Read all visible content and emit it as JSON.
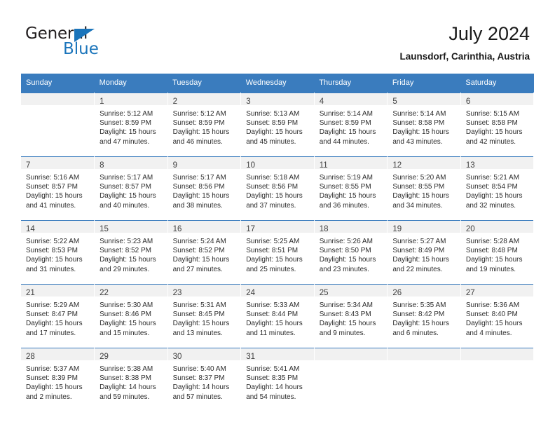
{
  "brand": {
    "name_part1": "General",
    "name_part2": "Blue",
    "accent_color": "#1b75bb"
  },
  "header": {
    "title": "July 2024",
    "subtitle": "Launsdorf, Carinthia, Austria"
  },
  "theme": {
    "header_row_color": "#3a7cbe",
    "daynum_band_color": "#f1f1f1",
    "text_color": "#2b2b2b"
  },
  "weekdays": [
    "Sunday",
    "Monday",
    "Tuesday",
    "Wednesday",
    "Thursday",
    "Friday",
    "Saturday"
  ],
  "weeks": [
    [
      {
        "day": "",
        "sunrise": "",
        "sunset": "",
        "daylight1": "",
        "daylight2": "",
        "empty": true
      },
      {
        "day": "1",
        "sunrise": "Sunrise: 5:12 AM",
        "sunset": "Sunset: 8:59 PM",
        "daylight1": "Daylight: 15 hours",
        "daylight2": "and 47 minutes."
      },
      {
        "day": "2",
        "sunrise": "Sunrise: 5:12 AM",
        "sunset": "Sunset: 8:59 PM",
        "daylight1": "Daylight: 15 hours",
        "daylight2": "and 46 minutes."
      },
      {
        "day": "3",
        "sunrise": "Sunrise: 5:13 AM",
        "sunset": "Sunset: 8:59 PM",
        "daylight1": "Daylight: 15 hours",
        "daylight2": "and 45 minutes."
      },
      {
        "day": "4",
        "sunrise": "Sunrise: 5:14 AM",
        "sunset": "Sunset: 8:59 PM",
        "daylight1": "Daylight: 15 hours",
        "daylight2": "and 44 minutes."
      },
      {
        "day": "5",
        "sunrise": "Sunrise: 5:14 AM",
        "sunset": "Sunset: 8:58 PM",
        "daylight1": "Daylight: 15 hours",
        "daylight2": "and 43 minutes."
      },
      {
        "day": "6",
        "sunrise": "Sunrise: 5:15 AM",
        "sunset": "Sunset: 8:58 PM",
        "daylight1": "Daylight: 15 hours",
        "daylight2": "and 42 minutes."
      }
    ],
    [
      {
        "day": "7",
        "sunrise": "Sunrise: 5:16 AM",
        "sunset": "Sunset: 8:57 PM",
        "daylight1": "Daylight: 15 hours",
        "daylight2": "and 41 minutes."
      },
      {
        "day": "8",
        "sunrise": "Sunrise: 5:17 AM",
        "sunset": "Sunset: 8:57 PM",
        "daylight1": "Daylight: 15 hours",
        "daylight2": "and 40 minutes."
      },
      {
        "day": "9",
        "sunrise": "Sunrise: 5:17 AM",
        "sunset": "Sunset: 8:56 PM",
        "daylight1": "Daylight: 15 hours",
        "daylight2": "and 38 minutes."
      },
      {
        "day": "10",
        "sunrise": "Sunrise: 5:18 AM",
        "sunset": "Sunset: 8:56 PM",
        "daylight1": "Daylight: 15 hours",
        "daylight2": "and 37 minutes."
      },
      {
        "day": "11",
        "sunrise": "Sunrise: 5:19 AM",
        "sunset": "Sunset: 8:55 PM",
        "daylight1": "Daylight: 15 hours",
        "daylight2": "and 36 minutes."
      },
      {
        "day": "12",
        "sunrise": "Sunrise: 5:20 AM",
        "sunset": "Sunset: 8:55 PM",
        "daylight1": "Daylight: 15 hours",
        "daylight2": "and 34 minutes."
      },
      {
        "day": "13",
        "sunrise": "Sunrise: 5:21 AM",
        "sunset": "Sunset: 8:54 PM",
        "daylight1": "Daylight: 15 hours",
        "daylight2": "and 32 minutes."
      }
    ],
    [
      {
        "day": "14",
        "sunrise": "Sunrise: 5:22 AM",
        "sunset": "Sunset: 8:53 PM",
        "daylight1": "Daylight: 15 hours",
        "daylight2": "and 31 minutes."
      },
      {
        "day": "15",
        "sunrise": "Sunrise: 5:23 AM",
        "sunset": "Sunset: 8:52 PM",
        "daylight1": "Daylight: 15 hours",
        "daylight2": "and 29 minutes."
      },
      {
        "day": "16",
        "sunrise": "Sunrise: 5:24 AM",
        "sunset": "Sunset: 8:52 PM",
        "daylight1": "Daylight: 15 hours",
        "daylight2": "and 27 minutes."
      },
      {
        "day": "17",
        "sunrise": "Sunrise: 5:25 AM",
        "sunset": "Sunset: 8:51 PM",
        "daylight1": "Daylight: 15 hours",
        "daylight2": "and 25 minutes."
      },
      {
        "day": "18",
        "sunrise": "Sunrise: 5:26 AM",
        "sunset": "Sunset: 8:50 PM",
        "daylight1": "Daylight: 15 hours",
        "daylight2": "and 23 minutes."
      },
      {
        "day": "19",
        "sunrise": "Sunrise: 5:27 AM",
        "sunset": "Sunset: 8:49 PM",
        "daylight1": "Daylight: 15 hours",
        "daylight2": "and 22 minutes."
      },
      {
        "day": "20",
        "sunrise": "Sunrise: 5:28 AM",
        "sunset": "Sunset: 8:48 PM",
        "daylight1": "Daylight: 15 hours",
        "daylight2": "and 19 minutes."
      }
    ],
    [
      {
        "day": "21",
        "sunrise": "Sunrise: 5:29 AM",
        "sunset": "Sunset: 8:47 PM",
        "daylight1": "Daylight: 15 hours",
        "daylight2": "and 17 minutes."
      },
      {
        "day": "22",
        "sunrise": "Sunrise: 5:30 AM",
        "sunset": "Sunset: 8:46 PM",
        "daylight1": "Daylight: 15 hours",
        "daylight2": "and 15 minutes."
      },
      {
        "day": "23",
        "sunrise": "Sunrise: 5:31 AM",
        "sunset": "Sunset: 8:45 PM",
        "daylight1": "Daylight: 15 hours",
        "daylight2": "and 13 minutes."
      },
      {
        "day": "24",
        "sunrise": "Sunrise: 5:33 AM",
        "sunset": "Sunset: 8:44 PM",
        "daylight1": "Daylight: 15 hours",
        "daylight2": "and 11 minutes."
      },
      {
        "day": "25",
        "sunrise": "Sunrise: 5:34 AM",
        "sunset": "Sunset: 8:43 PM",
        "daylight1": "Daylight: 15 hours",
        "daylight2": "and 9 minutes."
      },
      {
        "day": "26",
        "sunrise": "Sunrise: 5:35 AM",
        "sunset": "Sunset: 8:42 PM",
        "daylight1": "Daylight: 15 hours",
        "daylight2": "and 6 minutes."
      },
      {
        "day": "27",
        "sunrise": "Sunrise: 5:36 AM",
        "sunset": "Sunset: 8:40 PM",
        "daylight1": "Daylight: 15 hours",
        "daylight2": "and 4 minutes."
      }
    ],
    [
      {
        "day": "28",
        "sunrise": "Sunrise: 5:37 AM",
        "sunset": "Sunset: 8:39 PM",
        "daylight1": "Daylight: 15 hours",
        "daylight2": "and 2 minutes."
      },
      {
        "day": "29",
        "sunrise": "Sunrise: 5:38 AM",
        "sunset": "Sunset: 8:38 PM",
        "daylight1": "Daylight: 14 hours",
        "daylight2": "and 59 minutes."
      },
      {
        "day": "30",
        "sunrise": "Sunrise: 5:40 AM",
        "sunset": "Sunset: 8:37 PM",
        "daylight1": "Daylight: 14 hours",
        "daylight2": "and 57 minutes."
      },
      {
        "day": "31",
        "sunrise": "Sunrise: 5:41 AM",
        "sunset": "Sunset: 8:35 PM",
        "daylight1": "Daylight: 14 hours",
        "daylight2": "and 54 minutes."
      },
      {
        "day": "",
        "sunrise": "",
        "sunset": "",
        "daylight1": "",
        "daylight2": "",
        "empty": true
      },
      {
        "day": "",
        "sunrise": "",
        "sunset": "",
        "daylight1": "",
        "daylight2": "",
        "empty": true
      },
      {
        "day": "",
        "sunrise": "",
        "sunset": "",
        "daylight1": "",
        "daylight2": "",
        "empty": true
      }
    ]
  ]
}
